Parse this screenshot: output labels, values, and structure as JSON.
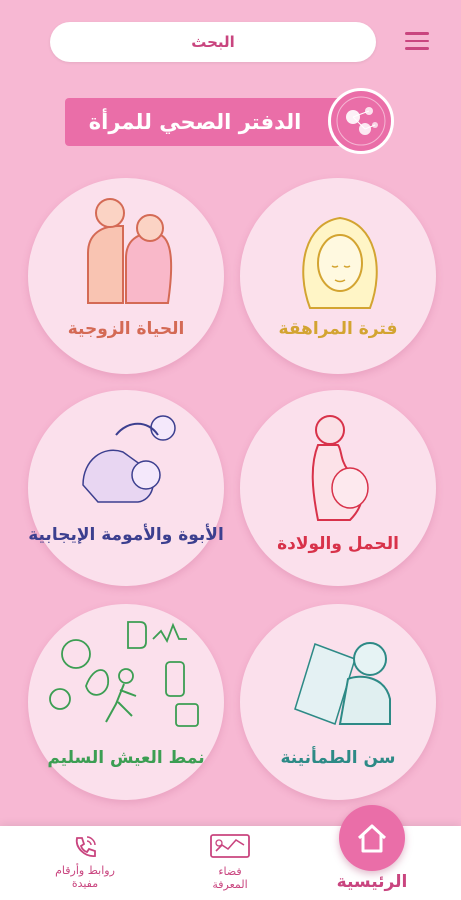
{
  "header": {
    "search_label": "البحث",
    "menu_icon": "hamburger-menu-icon"
  },
  "banner": {
    "title": "الدفتر الصحي للمرأة",
    "logo_icon": "women-health-logo-icon"
  },
  "tiles": [
    {
      "label": "فترة المراهقة",
      "color": "#d3a431",
      "icon": "teen-girl-illustration"
    },
    {
      "label": "الحياة الزوجية",
      "color": "#d46a55",
      "icon": "couple-illustration"
    },
    {
      "label": "الحمل والولادة",
      "color": "#d8324a",
      "icon": "pregnant-woman-illustration"
    },
    {
      "label": "الأبوة والأمومة الإيجابية",
      "color": "#3c3f8f",
      "icon": "parent-child-illustration"
    },
    {
      "label": "سن الطمأنينة",
      "color": "#2d8a86",
      "icon": "older-woman-illustration"
    },
    {
      "label": "نمط العيش السليم",
      "color": "#3c9e53",
      "icon": "healthy-lifestyle-illustration"
    }
  ],
  "bottom_nav": {
    "home_label": "الرئيسية",
    "knowledge_label_line1": "فضاء",
    "knowledge_label_line2": "المعرفة",
    "links_label_line1": "روابط وأرقام",
    "links_label_line2": "مفيدة",
    "colors": {
      "accent": "#ea6ea8",
      "text": "#c9457f"
    }
  }
}
